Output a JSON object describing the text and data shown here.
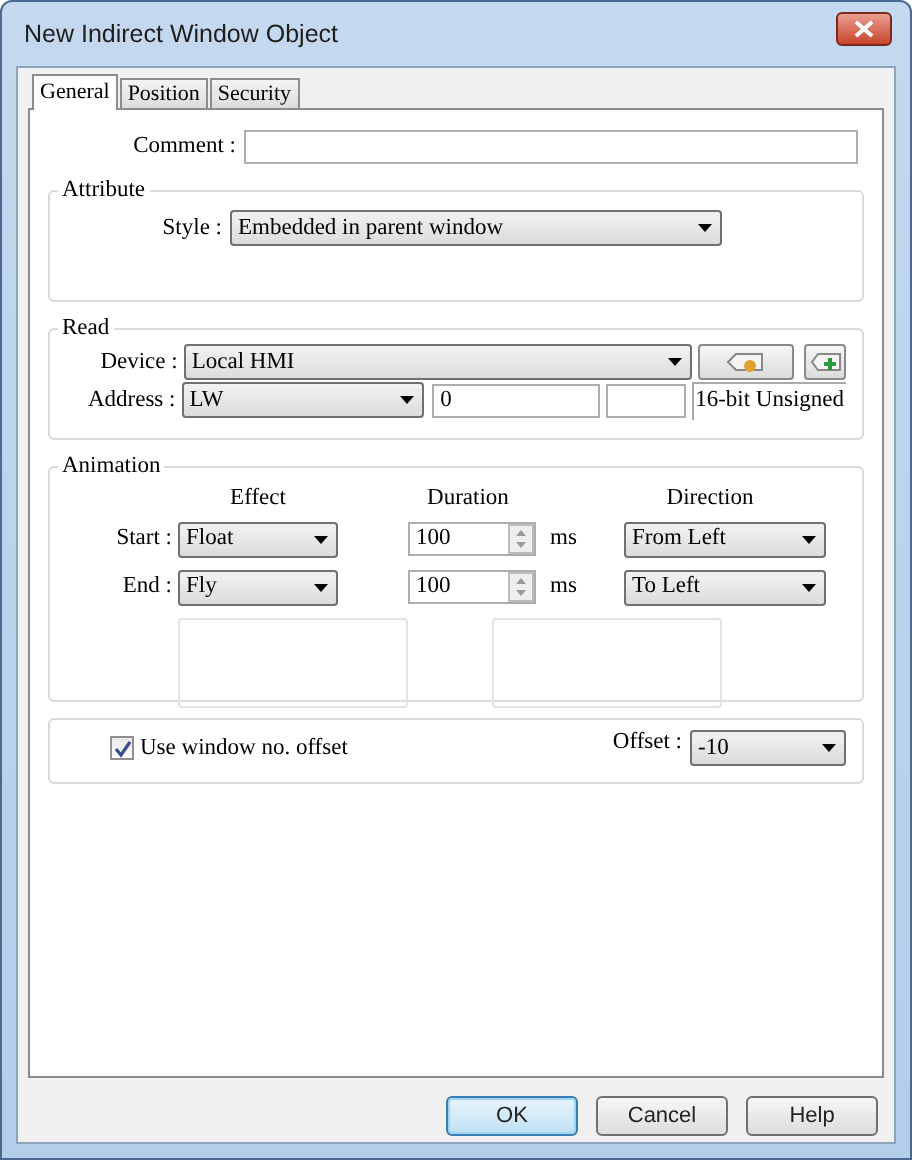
{
  "window": {
    "title": "New Indirect Window Object"
  },
  "tabs": [
    {
      "label": "General",
      "selected": true
    },
    {
      "label": "Position",
      "selected": false
    },
    {
      "label": "Security",
      "selected": false
    }
  ],
  "comment": {
    "label": "Comment :"
  },
  "attribute": {
    "title": "Attribute",
    "style_label": "Style :",
    "style_value": "Embedded in parent window"
  },
  "read": {
    "title": "Read",
    "device_label": "Device :",
    "device_value": "Local HMI",
    "address_label": "Address :",
    "address_type": "LW",
    "address_value": "0",
    "data_format": "16-bit Unsigned"
  },
  "animation": {
    "title": "Animation",
    "columns": [
      "Effect",
      "Duration",
      "Direction"
    ],
    "rows": [
      {
        "label": "Start :",
        "effect": "Float",
        "duration": "100",
        "unit": "ms",
        "direction": "From Left"
      },
      {
        "label": "End :",
        "effect": "Fly",
        "duration": "100",
        "unit": "ms",
        "direction": "To Left"
      }
    ]
  },
  "offset": {
    "checkbox_label": "Use window no. offset",
    "checked": true,
    "offset_label": "Offset :",
    "offset_value": "-10"
  },
  "buttons": [
    {
      "label": "OK",
      "default": true
    },
    {
      "label": "Cancel",
      "default": false
    },
    {
      "label": "Help",
      "default": false
    }
  ]
}
